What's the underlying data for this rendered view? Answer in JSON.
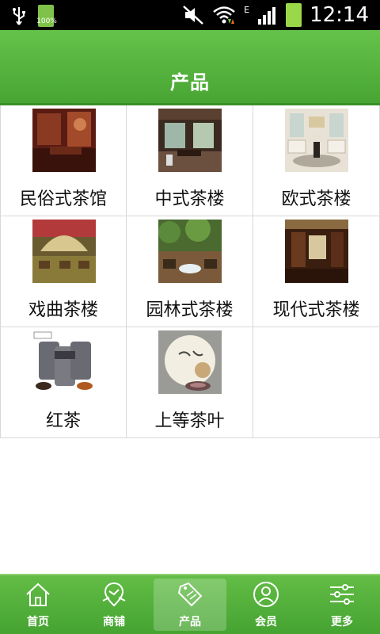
{
  "status": {
    "battery_small": "100%",
    "network": "E",
    "time": "12:14"
  },
  "header": {
    "title": "产品"
  },
  "products": [
    {
      "label": "民俗式茶馆",
      "icon": "folk-teahouse-photo"
    },
    {
      "label": "中式茶楼",
      "icon": "chinese-teahouse-photo"
    },
    {
      "label": "欧式茶楼",
      "icon": "european-teahouse-photo"
    },
    {
      "label": "戏曲茶楼",
      "icon": "opera-teahouse-photo"
    },
    {
      "label": "园林式茶楼",
      "icon": "garden-teahouse-photo"
    },
    {
      "label": "现代式茶楼",
      "icon": "modern-teahouse-photo"
    },
    {
      "label": "红茶",
      "icon": "black-tea-photo"
    },
    {
      "label": "上等茶叶",
      "icon": "premium-tea-photo"
    }
  ],
  "nav": [
    {
      "label": "首页",
      "icon": "home-icon"
    },
    {
      "label": "商铺",
      "icon": "map-pin-icon"
    },
    {
      "label": "产品",
      "icon": "sale-tag-icon",
      "active": true
    },
    {
      "label": "会员",
      "icon": "user-icon"
    },
    {
      "label": "更多",
      "icon": "settings-sliders-icon"
    }
  ],
  "colors": {
    "accent": "#4fae38",
    "header_top": "#65c24a",
    "header_bottom": "#48a533"
  }
}
